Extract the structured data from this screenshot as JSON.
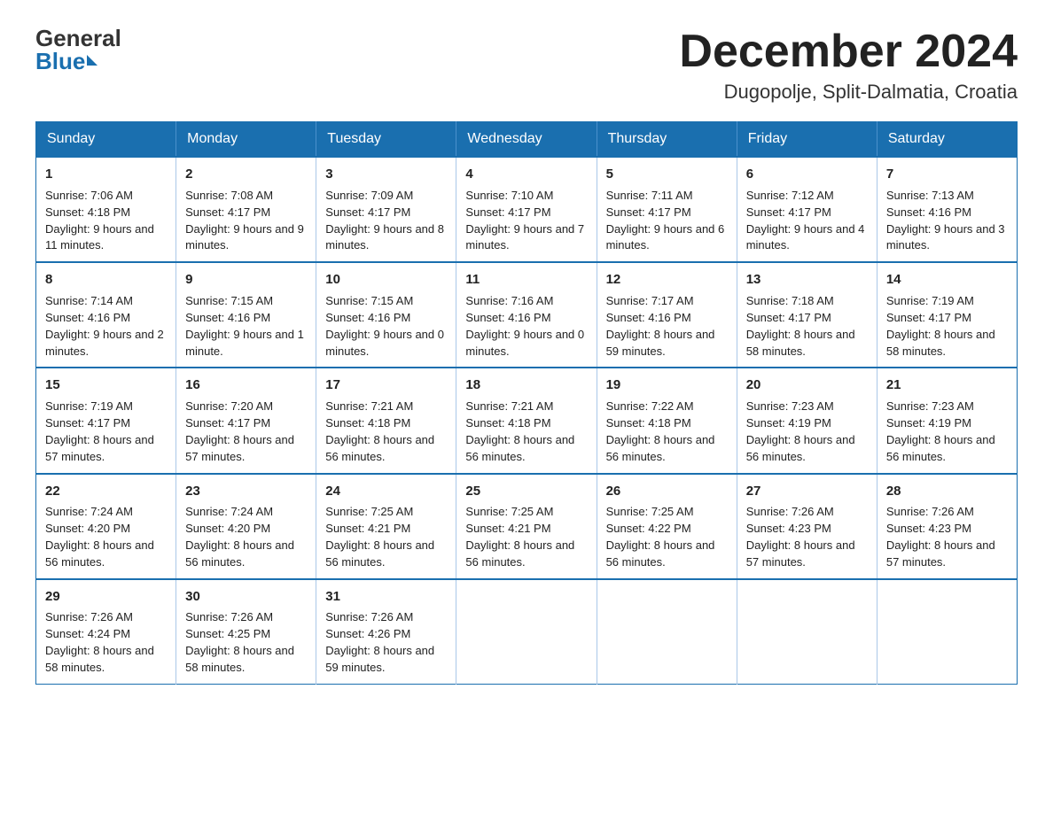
{
  "logo": {
    "general": "General",
    "blue": "Blue"
  },
  "title": "December 2024",
  "location": "Dugopolje, Split-Dalmatia, Croatia",
  "days_of_week": [
    "Sunday",
    "Monday",
    "Tuesday",
    "Wednesday",
    "Thursday",
    "Friday",
    "Saturday"
  ],
  "weeks": [
    [
      {
        "day": "1",
        "sunrise": "Sunrise: 7:06 AM",
        "sunset": "Sunset: 4:18 PM",
        "daylight": "Daylight: 9 hours and 11 minutes."
      },
      {
        "day": "2",
        "sunrise": "Sunrise: 7:08 AM",
        "sunset": "Sunset: 4:17 PM",
        "daylight": "Daylight: 9 hours and 9 minutes."
      },
      {
        "day": "3",
        "sunrise": "Sunrise: 7:09 AM",
        "sunset": "Sunset: 4:17 PM",
        "daylight": "Daylight: 9 hours and 8 minutes."
      },
      {
        "day": "4",
        "sunrise": "Sunrise: 7:10 AM",
        "sunset": "Sunset: 4:17 PM",
        "daylight": "Daylight: 9 hours and 7 minutes."
      },
      {
        "day": "5",
        "sunrise": "Sunrise: 7:11 AM",
        "sunset": "Sunset: 4:17 PM",
        "daylight": "Daylight: 9 hours and 6 minutes."
      },
      {
        "day": "6",
        "sunrise": "Sunrise: 7:12 AM",
        "sunset": "Sunset: 4:17 PM",
        "daylight": "Daylight: 9 hours and 4 minutes."
      },
      {
        "day": "7",
        "sunrise": "Sunrise: 7:13 AM",
        "sunset": "Sunset: 4:16 PM",
        "daylight": "Daylight: 9 hours and 3 minutes."
      }
    ],
    [
      {
        "day": "8",
        "sunrise": "Sunrise: 7:14 AM",
        "sunset": "Sunset: 4:16 PM",
        "daylight": "Daylight: 9 hours and 2 minutes."
      },
      {
        "day": "9",
        "sunrise": "Sunrise: 7:15 AM",
        "sunset": "Sunset: 4:16 PM",
        "daylight": "Daylight: 9 hours and 1 minute."
      },
      {
        "day": "10",
        "sunrise": "Sunrise: 7:15 AM",
        "sunset": "Sunset: 4:16 PM",
        "daylight": "Daylight: 9 hours and 0 minutes."
      },
      {
        "day": "11",
        "sunrise": "Sunrise: 7:16 AM",
        "sunset": "Sunset: 4:16 PM",
        "daylight": "Daylight: 9 hours and 0 minutes."
      },
      {
        "day": "12",
        "sunrise": "Sunrise: 7:17 AM",
        "sunset": "Sunset: 4:16 PM",
        "daylight": "Daylight: 8 hours and 59 minutes."
      },
      {
        "day": "13",
        "sunrise": "Sunrise: 7:18 AM",
        "sunset": "Sunset: 4:17 PM",
        "daylight": "Daylight: 8 hours and 58 minutes."
      },
      {
        "day": "14",
        "sunrise": "Sunrise: 7:19 AM",
        "sunset": "Sunset: 4:17 PM",
        "daylight": "Daylight: 8 hours and 58 minutes."
      }
    ],
    [
      {
        "day": "15",
        "sunrise": "Sunrise: 7:19 AM",
        "sunset": "Sunset: 4:17 PM",
        "daylight": "Daylight: 8 hours and 57 minutes."
      },
      {
        "day": "16",
        "sunrise": "Sunrise: 7:20 AM",
        "sunset": "Sunset: 4:17 PM",
        "daylight": "Daylight: 8 hours and 57 minutes."
      },
      {
        "day": "17",
        "sunrise": "Sunrise: 7:21 AM",
        "sunset": "Sunset: 4:18 PM",
        "daylight": "Daylight: 8 hours and 56 minutes."
      },
      {
        "day": "18",
        "sunrise": "Sunrise: 7:21 AM",
        "sunset": "Sunset: 4:18 PM",
        "daylight": "Daylight: 8 hours and 56 minutes."
      },
      {
        "day": "19",
        "sunrise": "Sunrise: 7:22 AM",
        "sunset": "Sunset: 4:18 PM",
        "daylight": "Daylight: 8 hours and 56 minutes."
      },
      {
        "day": "20",
        "sunrise": "Sunrise: 7:23 AM",
        "sunset": "Sunset: 4:19 PM",
        "daylight": "Daylight: 8 hours and 56 minutes."
      },
      {
        "day": "21",
        "sunrise": "Sunrise: 7:23 AM",
        "sunset": "Sunset: 4:19 PM",
        "daylight": "Daylight: 8 hours and 56 minutes."
      }
    ],
    [
      {
        "day": "22",
        "sunrise": "Sunrise: 7:24 AM",
        "sunset": "Sunset: 4:20 PM",
        "daylight": "Daylight: 8 hours and 56 minutes."
      },
      {
        "day": "23",
        "sunrise": "Sunrise: 7:24 AM",
        "sunset": "Sunset: 4:20 PM",
        "daylight": "Daylight: 8 hours and 56 minutes."
      },
      {
        "day": "24",
        "sunrise": "Sunrise: 7:25 AM",
        "sunset": "Sunset: 4:21 PM",
        "daylight": "Daylight: 8 hours and 56 minutes."
      },
      {
        "day": "25",
        "sunrise": "Sunrise: 7:25 AM",
        "sunset": "Sunset: 4:21 PM",
        "daylight": "Daylight: 8 hours and 56 minutes."
      },
      {
        "day": "26",
        "sunrise": "Sunrise: 7:25 AM",
        "sunset": "Sunset: 4:22 PM",
        "daylight": "Daylight: 8 hours and 56 minutes."
      },
      {
        "day": "27",
        "sunrise": "Sunrise: 7:26 AM",
        "sunset": "Sunset: 4:23 PM",
        "daylight": "Daylight: 8 hours and 57 minutes."
      },
      {
        "day": "28",
        "sunrise": "Sunrise: 7:26 AM",
        "sunset": "Sunset: 4:23 PM",
        "daylight": "Daylight: 8 hours and 57 minutes."
      }
    ],
    [
      {
        "day": "29",
        "sunrise": "Sunrise: 7:26 AM",
        "sunset": "Sunset: 4:24 PM",
        "daylight": "Daylight: 8 hours and 58 minutes."
      },
      {
        "day": "30",
        "sunrise": "Sunrise: 7:26 AM",
        "sunset": "Sunset: 4:25 PM",
        "daylight": "Daylight: 8 hours and 58 minutes."
      },
      {
        "day": "31",
        "sunrise": "Sunrise: 7:26 AM",
        "sunset": "Sunset: 4:26 PM",
        "daylight": "Daylight: 8 hours and 59 minutes."
      },
      null,
      null,
      null,
      null
    ]
  ]
}
